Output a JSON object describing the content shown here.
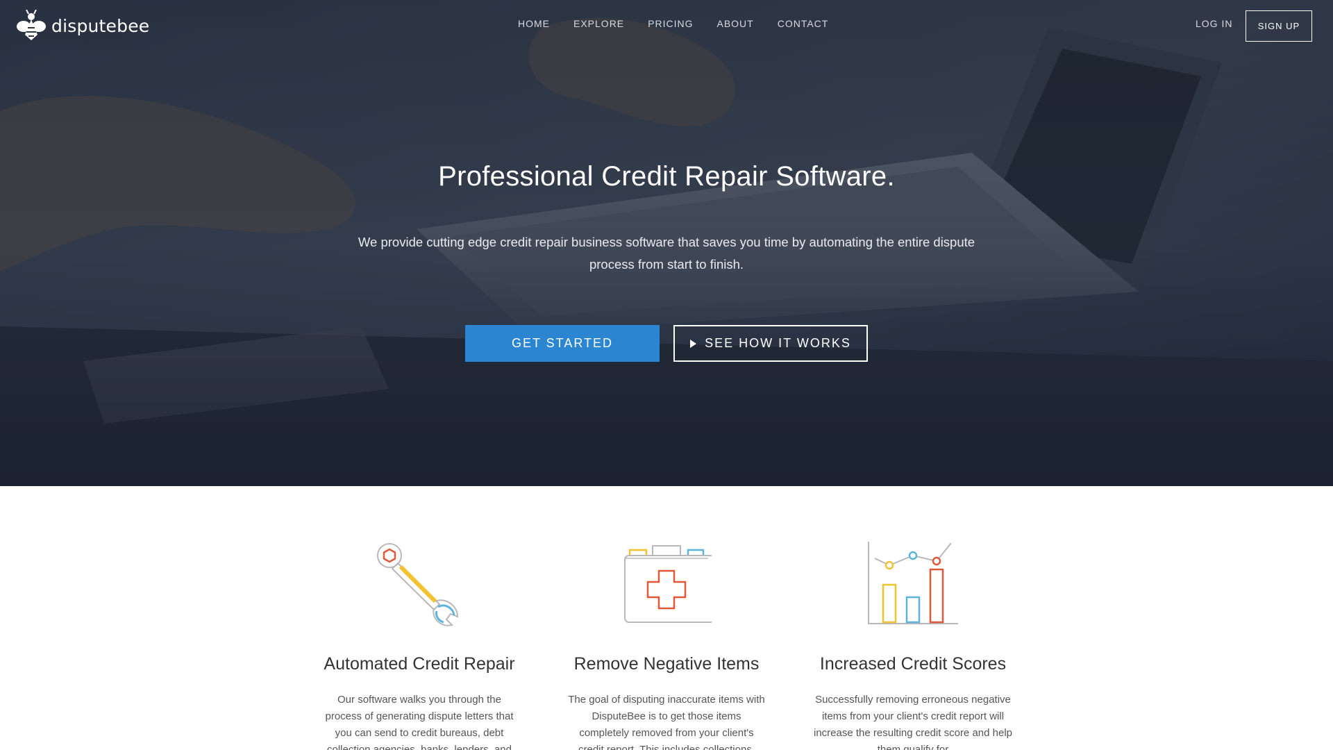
{
  "brand": {
    "name": "disputebee"
  },
  "nav": {
    "links": [
      "HOME",
      "EXPLORE",
      "PRICING",
      "ABOUT",
      "CONTACT"
    ],
    "login": "LOG IN",
    "signup": "SIGN UP"
  },
  "hero": {
    "title": "Professional Credit Repair Software.",
    "subtitle": "We provide cutting edge credit repair business software that saves you time by automating the entire dispute process from start to finish.",
    "primary_cta": "GET STARTED",
    "secondary_cta": "SEE HOW IT WORKS"
  },
  "features": [
    {
      "icon": "wrench-icon",
      "title": "Automated Credit Repair",
      "text": "Our software walks you through the process of generating dispute letters that you can send to credit bureaus, debt collection agencies, banks, lenders, and"
    },
    {
      "icon": "first-aid-kit-icon",
      "title": "Remove Negative Items",
      "text": "The goal of disputing inaccurate items with DisputeBee is to get those items completely removed from your client's credit report. This includes collections,"
    },
    {
      "icon": "bar-chart-icon",
      "title": "Increased Credit Scores",
      "text": "Successfully removing erroneous negative items from your client's credit report will increase the resulting credit score and help them qualify for"
    }
  ],
  "colors": {
    "accent": "#2b85d0",
    "icon_orange": "#e0583a",
    "icon_yellow": "#f2c230",
    "icon_blue": "#5cb3dc",
    "icon_gray": "#b8b8b8"
  }
}
